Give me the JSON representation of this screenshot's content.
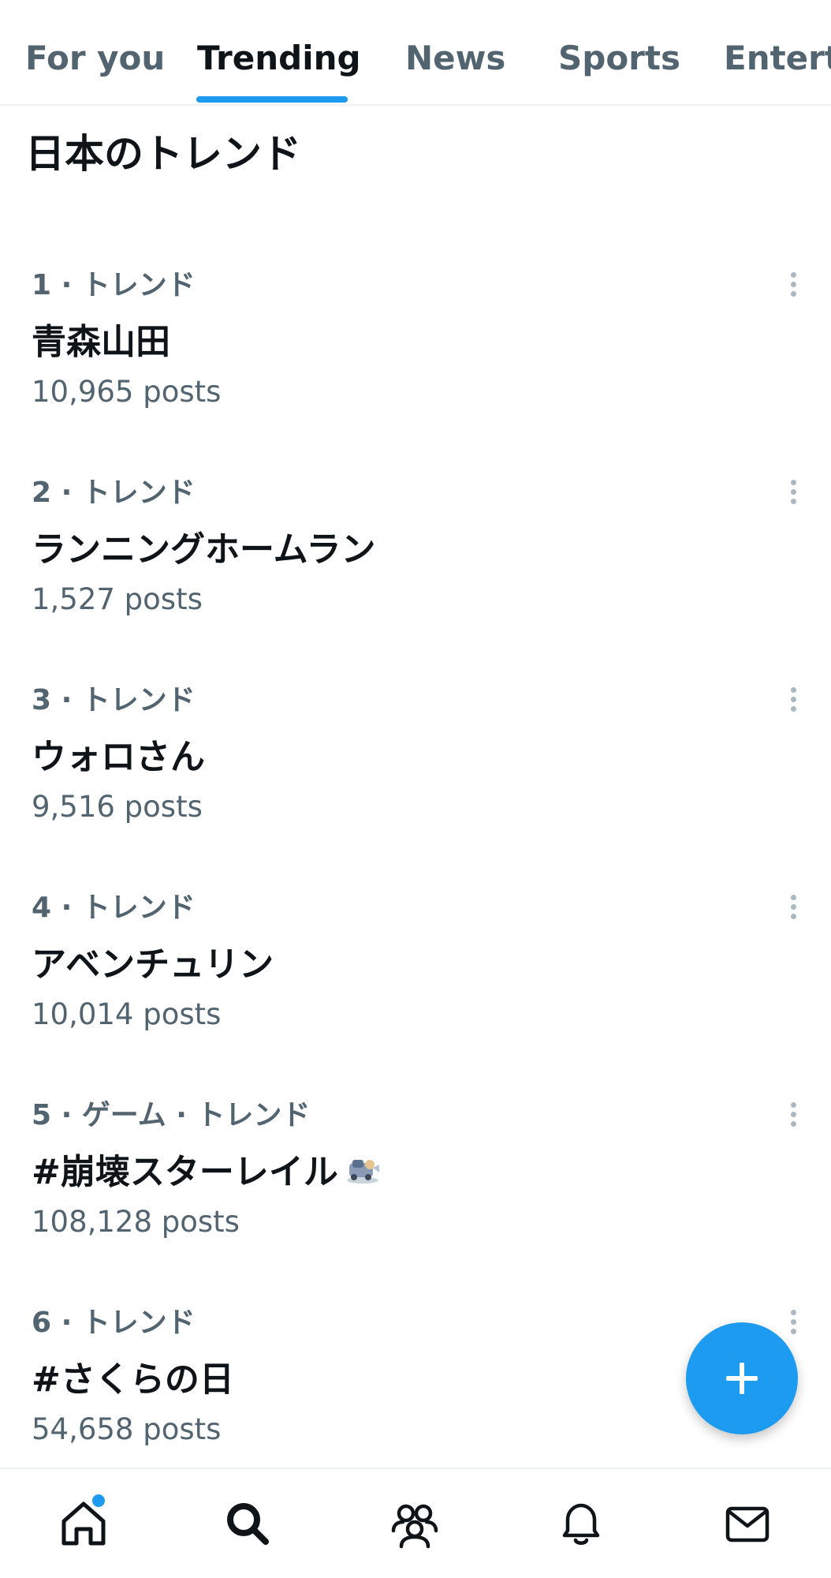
{
  "accent_color": "#1d9bf0",
  "tabs": [
    {
      "label": "For you",
      "active": false
    },
    {
      "label": "Trending",
      "active": true
    },
    {
      "label": "News",
      "active": false
    },
    {
      "label": "Sports",
      "active": false
    },
    {
      "label": "Entertainment",
      "active": false
    }
  ],
  "section_title": "日本のトレンド",
  "trends": [
    {
      "meta": "1 · トレンド",
      "name": "青森山田",
      "posts": "10,965 posts"
    },
    {
      "meta": "2 · トレンド",
      "name": "ランニングホームラン",
      "posts": "1,527 posts"
    },
    {
      "meta": "3 · トレンド",
      "name": "ウォロさん",
      "posts": "9,516 posts"
    },
    {
      "meta": "4 · トレンド",
      "name": "アベンチュリン",
      "posts": "10,014 posts"
    },
    {
      "meta": "5 · ゲーム · トレンド",
      "name": "#崩壊スターレイル",
      "posts": "108,128 posts",
      "icon": "hashflag-train-icon"
    },
    {
      "meta": "6 · トレンド",
      "name": "#さくらの日",
      "posts": "54,658 posts"
    }
  ],
  "compose_button": {
    "icon": "plus-icon"
  },
  "bottom_nav": [
    {
      "icon": "home-icon",
      "badge": true
    },
    {
      "icon": "search-icon",
      "badge": false
    },
    {
      "icon": "communities-icon",
      "badge": false
    },
    {
      "icon": "notifications-bell-icon",
      "badge": false
    },
    {
      "icon": "messages-envelope-icon",
      "badge": false
    }
  ]
}
